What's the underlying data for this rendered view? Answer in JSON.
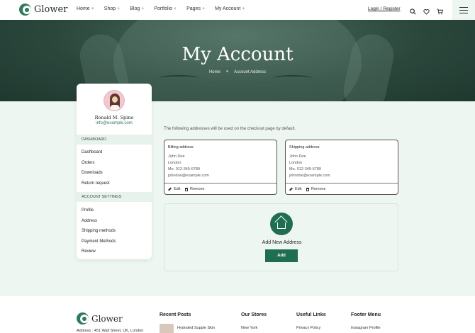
{
  "brand": {
    "name": "Glower"
  },
  "nav": {
    "items": [
      {
        "label": "Home"
      },
      {
        "label": "Shop"
      },
      {
        "label": "Blog"
      },
      {
        "label": "Portfolio"
      },
      {
        "label": "Pages"
      },
      {
        "label": "My Account"
      }
    ],
    "plus": "+",
    "login": "Login / Register",
    "icons": [
      "search-icon",
      "heart-icon",
      "cart-icon",
      "menu-icon"
    ]
  },
  "hero": {
    "title": "My Account",
    "breadcrumb": {
      "home": "Home",
      "current": "Account Address"
    }
  },
  "sidebar": {
    "user": {
      "name": "Ronald M. Spino",
      "email": "info@example.com"
    },
    "dashboard_heading": "DASHBOARD",
    "dashboard_items": [
      "Dashboard",
      "Orders",
      "Downloads",
      "Return request"
    ],
    "settings_heading": "ACCOUNT SETTINGS",
    "settings_items": [
      "Profile",
      "Address",
      "Shipping methods",
      "Payment Methods",
      "Review"
    ]
  },
  "main": {
    "intro": "The following addresses will be used on the checkout page by default.",
    "billing": {
      "title": "Billing address",
      "lines": [
        "John Doe",
        "London",
        "Mo. 012-345-6789",
        "johndoe@example.com"
      ],
      "edit": "Edit",
      "remove": "Remove"
    },
    "shipping": {
      "title": "Shipping address",
      "lines": [
        "John Doe",
        "London",
        "Mo. 012-345-6789",
        "johndoe@example.com"
      ],
      "edit": "Edit",
      "remove": "Remove"
    },
    "add_address": {
      "title": "Add New Address",
      "button": "Add"
    }
  },
  "footer": {
    "brand": "Glower",
    "address": "Address : 451 Wall Street, UK, London",
    "recent_posts": {
      "heading": "Recent Posts",
      "first": "Hydrated Supple Skin"
    },
    "our_stores": {
      "heading": "Our Stores",
      "first": "New York"
    },
    "useful_links": {
      "heading": "Useful Links",
      "first": "Privacy Policy"
    },
    "footer_menu": {
      "heading": "Footer Menu",
      "first": "Instagram Profile"
    }
  },
  "colors": {
    "brand_green": "#1f6e50",
    "accent_green": "#2f7a5a",
    "page_bg": "#eef6f1"
  }
}
